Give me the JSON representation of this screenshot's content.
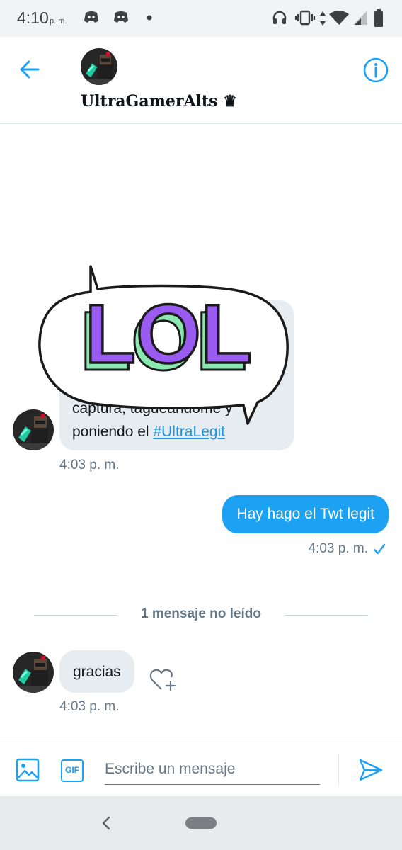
{
  "status_bar": {
    "time": "4:10",
    "time_suffix": "p. m.",
    "left_icons": [
      "discord-icon",
      "discord-icon",
      "notification-dot-icon"
    ],
    "right_icons": [
      "headphones-icon",
      "vibrate-icon",
      "data-arrows-icon",
      "wifi-icon",
      "signal-icon",
      "battery-icon"
    ]
  },
  "header": {
    "title": "UltraGamerAlts ♛",
    "back_icon": "arrow-left-icon",
    "info_icon": "info-icon"
  },
  "messages": [
    {
      "direction": "incoming",
      "lines": [
        "captura, tagueándome y",
        "poniendo el "
      ],
      "hashtag": "#UltraLegit",
      "sticker_text": "LOL",
      "time": "4:03 p. m."
    },
    {
      "direction": "outgoing",
      "text": "Hay hago el Twt legit",
      "time": "4:03 p. m.",
      "status_icon": "check-icon"
    },
    {
      "direction": "incoming",
      "text": "gracias",
      "time": "4:03 p. m.",
      "reaction_icon": "heart-plus-icon"
    }
  ],
  "unread_divider": "1 mensaje no leído",
  "composer": {
    "placeholder": "Escribe un mensaje",
    "value": "",
    "media_icon": "image-icon",
    "gif_label": "GIF",
    "send_icon": "send-icon"
  },
  "colors": {
    "accent": "#1da1f2",
    "incoming_bubble": "#e6ecf0",
    "secondary_text": "#657786",
    "sticker_purple": "#9a5cf0",
    "sticker_green": "#8be8b0"
  }
}
